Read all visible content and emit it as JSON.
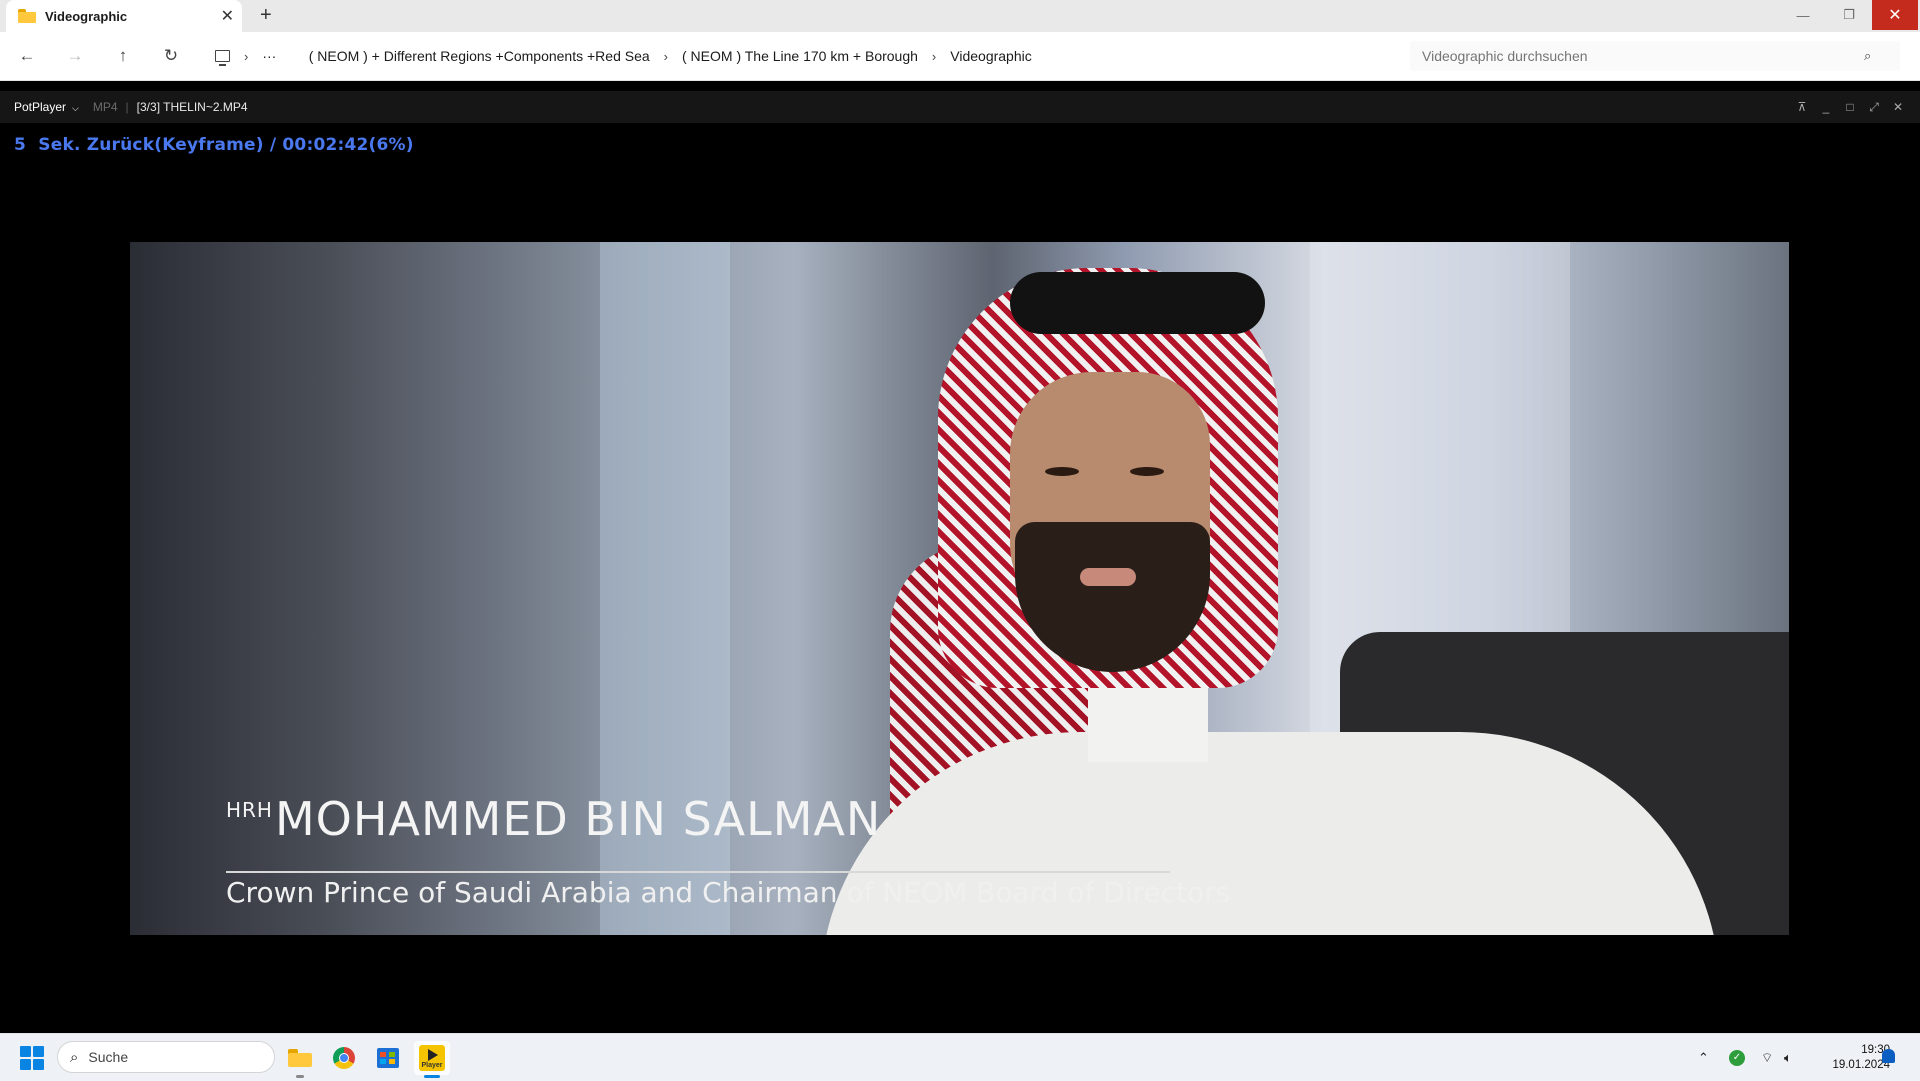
{
  "explorer": {
    "tab_title": "Videographic",
    "new_tab_label": "+",
    "breadcrumbs": [
      "( NEOM ) + Different Regions +Components +Red Sea",
      "( NEOM ) The Line 170 km + Borough",
      "Videographic"
    ],
    "overflow_label": "···",
    "search_placeholder": "Videographic durchsuchen",
    "folder_color": "#ffc83d"
  },
  "potplayer": {
    "menu_label": "PotPlayer",
    "format": "MP4",
    "file_title": "[3/3] THELIN~2.MP4",
    "osd_text": "5  Sek. Zurück(Keyframe) / 00:02:42(6%)",
    "osd_color": "#4a78ee",
    "video_overlay": {
      "honorific": "HRH",
      "name": "MOHAMMED BIN SALMAN",
      "subtitle": "Crown Prince of Saudi Arabia and Chairman of NEOM Board of Directors"
    }
  },
  "taskbar": {
    "search_label": "Suche",
    "apps": [
      "file-explorer",
      "chrome",
      "microsoft-store",
      "potplayer"
    ],
    "apps_pot_label": "Player",
    "time": "19:30",
    "date": "19.01.2024",
    "accent": "#0a84e3"
  }
}
